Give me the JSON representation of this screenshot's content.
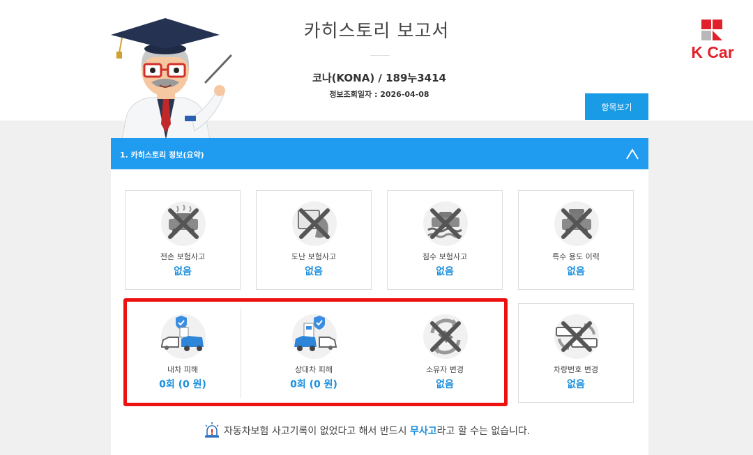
{
  "header": {
    "title": "카히스토리 보고서",
    "car_name": "코나(KONA) / 189누3414",
    "lookup_date": "정보조회일자 : 2026-04-08",
    "items_button": "항목보기",
    "logo_text": "K Car"
  },
  "section": {
    "title": "1. 카히스토리 정보(요약)",
    "cards": [
      {
        "label": "전손 보험사고",
        "value": "없음",
        "icon": "total-loss-car-icon"
      },
      {
        "label": "도난 보험사고",
        "value": "없음",
        "icon": "stolen-car-icon"
      },
      {
        "label": "침수 보험사고",
        "value": "없음",
        "icon": "flooded-car-icon"
      },
      {
        "label": "특수 용도 이력",
        "value": "없음",
        "icon": "special-use-car-icon"
      },
      {
        "label": "내차 피해",
        "value": "0회 (0 원)",
        "icon": "my-car-damage-icon"
      },
      {
        "label": "상대차 피해",
        "value": "0회 (0 원)",
        "icon": "other-car-damage-icon"
      },
      {
        "label": "소유자 변경",
        "value": "없음",
        "icon": "owner-change-icon"
      },
      {
        "label": "차량번호 변경",
        "value": "없음",
        "icon": "plate-change-icon"
      }
    ]
  },
  "notice": {
    "before": "자동차보험 사고기록이 없었다고 해서 반드시 ",
    "highlight": "무사고",
    "after": "라고 할 수는 없습니다."
  },
  "colors": {
    "accent": "#1f9bf0",
    "value_text": "#1a8fdd",
    "highlight_box": "#ee1111",
    "brand": "#e0202a"
  }
}
